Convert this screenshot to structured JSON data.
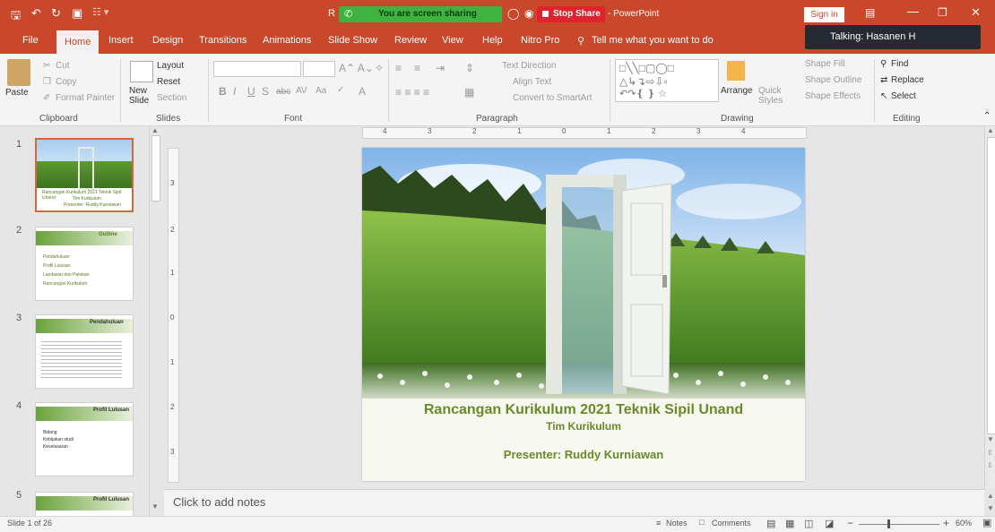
{
  "window": {
    "title": "- PowerPoint",
    "title_initial": "R",
    "sign_in": "Sign in"
  },
  "sharing": {
    "label": "You are screen sharing",
    "stop": "Stop Share"
  },
  "talking": "Talking: Hasanen H",
  "tabs": [
    "File",
    "Home",
    "Insert",
    "Design",
    "Transitions",
    "Animations",
    "Slide Show",
    "Review",
    "View",
    "Help",
    "Nitro Pro"
  ],
  "tell_me": "Tell me what you want to do",
  "ribbon": {
    "clipboard": {
      "paste": "Paste",
      "cut": "Cut",
      "copy": "Copy",
      "format_painter": "Format Painter",
      "group": "Clipboard"
    },
    "slides": {
      "new_slide": "New Slide",
      "layout": "Layout",
      "reset": "Reset",
      "section": "Section",
      "group": "Slides"
    },
    "font": {
      "group": "Font"
    },
    "paragraph": {
      "text_direction": "Text Direction",
      "align_text": "Align Text",
      "convert": "Convert to SmartArt",
      "group": "Paragraph"
    },
    "drawing": {
      "arrange": "Arrange",
      "quick_styles": "Quick Styles",
      "shape_fill": "Shape Fill",
      "shape_outline": "Shape Outline",
      "shape_effects": "Shape Effects",
      "group": "Drawing"
    },
    "editing": {
      "find": "Find",
      "replace": "Replace",
      "select": "Select",
      "group": "Editing"
    }
  },
  "thumbnails": [
    {
      "num": "1",
      "title": "Rancangan Kurikulum 2021 Teknik Sipil Unand",
      "sub": "Tim Kurikulum",
      "presenter": "Presenter: Ruddy Kurniawan"
    },
    {
      "num": "2",
      "title": "Outline",
      "items": [
        "Pendahuluan",
        "Profil Lulusan",
        "Landasan dan Patokan",
        "Rancangan Kurikulum"
      ]
    },
    {
      "num": "3",
      "title": "Pendahuluan"
    },
    {
      "num": "4",
      "title": "Profil Lulusan",
      "items": [
        "Bidang",
        "Kebijakan studi",
        "Keselasaran"
      ]
    },
    {
      "num": "5",
      "title": "Profil Lulusan"
    }
  ],
  "slide": {
    "title": "Rancangan Kurikulum 2021 Teknik Sipil Unand",
    "subtitle": "Tim Kurikulum",
    "presenter": "Presenter: Ruddy Kurniawan"
  },
  "notes_placeholder": "Click to add notes",
  "status": {
    "slide_info": "Slide 1 of 26",
    "notes": "Notes",
    "comments": "Comments",
    "zoom": "60%"
  },
  "ruler": {
    "top": [
      "4",
      "3",
      "2",
      "1",
      "0",
      "1",
      "2",
      "3",
      "4"
    ],
    "left": [
      "3",
      "2",
      "1",
      "0",
      "1",
      "2",
      "3"
    ]
  },
  "colors": {
    "accent": "#c9472a",
    "slide_title": "#6a8a2a",
    "share_green": "#3fb33f",
    "stop_red": "#e0222e"
  }
}
